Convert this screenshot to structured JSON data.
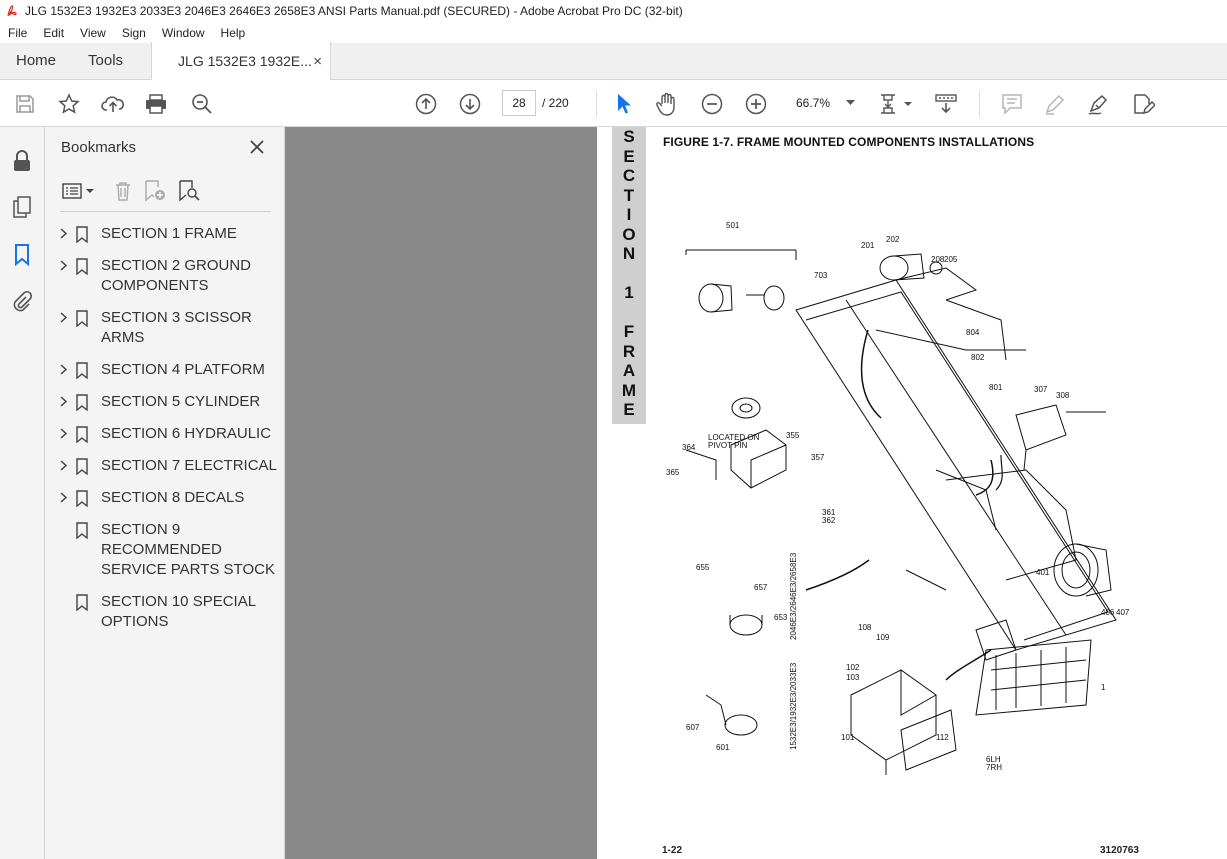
{
  "window": {
    "title": "JLG 1532E3 1932E3 2033E3 2046E3 2646E3 2658E3 ANSI Parts Manual.pdf (SECURED) - Adobe Acrobat Pro DC (32-bit)"
  },
  "menu": [
    "File",
    "Edit",
    "View",
    "Sign",
    "Window",
    "Help"
  ],
  "tabs": {
    "home": "Home",
    "tools": "Tools",
    "doc": "JLG 1532E3 1932E...",
    "close": "×"
  },
  "toolbar": {
    "page_current": "28",
    "page_total": "/ 220",
    "zoom": "66.7%"
  },
  "bookmarks": {
    "title": "Bookmarks",
    "items": [
      {
        "label": "SECTION 1 FRAME",
        "expandable": true
      },
      {
        "label": "SECTION 2 GROUND COMPONENTS",
        "expandable": true
      },
      {
        "label": "SECTION 3 SCISSOR ARMS",
        "expandable": true
      },
      {
        "label": "SECTION 4 PLATFORM",
        "expandable": true
      },
      {
        "label": "SECTION 5 CYLINDER",
        "expandable": true
      },
      {
        "label": "SECTION 6 HYDRAULIC",
        "expandable": true
      },
      {
        "label": "SECTION 7 ELECTRICAL",
        "expandable": true
      },
      {
        "label": "SECTION 8 DECALS",
        "expandable": true
      },
      {
        "label": "SECTION 9 RECOMMENDED SERVICE PARTS STOCK",
        "expandable": false
      },
      {
        "label": "SECTION 10 SPECIAL OPTIONS",
        "expandable": false
      }
    ]
  },
  "document": {
    "section_strip": [
      "S",
      "E",
      "C",
      "T",
      "I",
      "O",
      "N",
      "",
      "1",
      "",
      "F",
      "R",
      "A",
      "M",
      "E"
    ],
    "figure_title": "FIGURE 1-7.   FRAME MOUNTED COMPONENTS INSTALLATIONS",
    "page_left": "1-22",
    "page_right": "3120763",
    "callouts": {
      "pivot_note": "LOCATED ON PIVOT PIN",
      "model_a": "2046E3/2646E3/2658E3",
      "model_b": "1532E3/1932E3/2033E3",
      "lh_rh": "6LH 7RH"
    }
  }
}
